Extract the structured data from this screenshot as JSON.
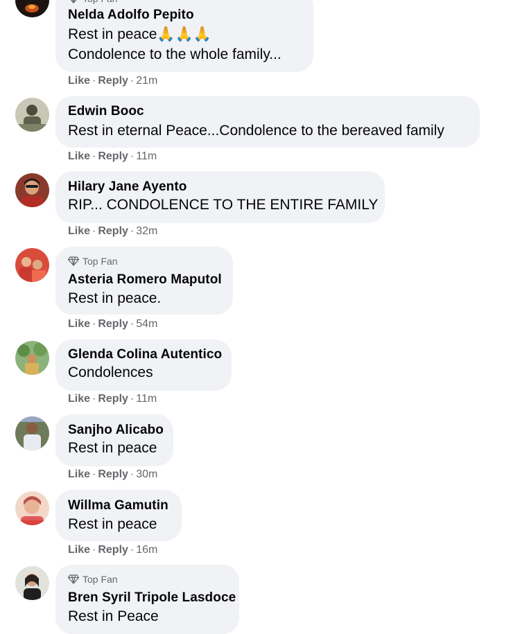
{
  "colors": {
    "bubble_bg": "#f0f2f5",
    "text": "#050505",
    "secondary": "#65676b",
    "page_bg": "#ffffff"
  },
  "actions": {
    "like": "Like",
    "reply": "Reply",
    "separator": "·"
  },
  "top_fan_label": "Top Fan",
  "comments": [
    {
      "author": "Nelda Adolfo Pepito",
      "top_fan": true,
      "lines": [
        "Rest in peace🙏🙏🙏",
        "Condolence to the whole family..."
      ],
      "time": "21m"
    },
    {
      "author": "Edwin Booc",
      "top_fan": false,
      "lines": [
        "Rest in eternal Peace...Condolence to the bereaved family"
      ],
      "time": "11m"
    },
    {
      "author": "Hilary Jane Ayento",
      "top_fan": false,
      "lines": [
        "RIP... CONDOLENCE TO THE ENTIRE FAMILY"
      ],
      "time": "32m"
    },
    {
      "author": "Asteria Romero Maputol",
      "top_fan": true,
      "lines": [
        "Rest in peace."
      ],
      "time": "54m"
    },
    {
      "author": "Glenda Colina Autentico",
      "top_fan": false,
      "lines": [
        "Condolences"
      ],
      "time": "11m"
    },
    {
      "author": "Sanjho Alicabo",
      "top_fan": false,
      "lines": [
        "Rest in peace"
      ],
      "time": "30m"
    },
    {
      "author": "Willma Gamutin",
      "top_fan": false,
      "lines": [
        "Rest in peace"
      ],
      "time": "16m"
    },
    {
      "author": "Bren Syril Tripole Lasdoce",
      "top_fan": true,
      "lines": [
        "Rest in Peace"
      ],
      "time": ""
    }
  ]
}
